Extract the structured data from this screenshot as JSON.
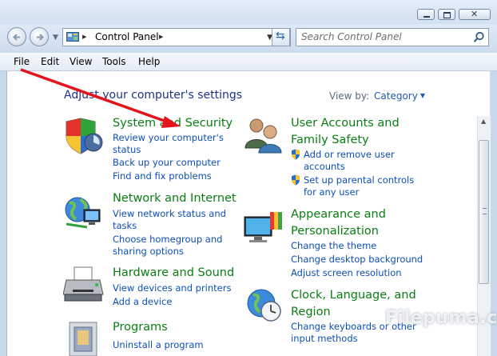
{
  "address_bar": {
    "crumb": "Control Panel",
    "search_placeholder": "Search Control Panel"
  },
  "menubar": [
    "File",
    "Edit",
    "View",
    "Tools",
    "Help"
  ],
  "heading": "Adjust your computer's settings",
  "view_by": {
    "label": "View by:",
    "value": "Category"
  },
  "categories": [
    {
      "title": [
        "System and Security"
      ],
      "links": [
        [
          "Review your computer's",
          "status"
        ],
        [
          "Back up your computer"
        ],
        [
          "Find and fix problems"
        ]
      ]
    },
    {
      "title": [
        "Network and Internet"
      ],
      "links": [
        [
          "View network status and",
          "tasks"
        ],
        [
          "Choose homegroup and",
          "sharing options"
        ]
      ]
    },
    {
      "title": [
        "Hardware and Sound"
      ],
      "links": [
        [
          "View devices and printers"
        ],
        [
          "Add a device"
        ]
      ]
    },
    {
      "title": [
        "Programs"
      ],
      "links": [
        [
          "Uninstall a program"
        ]
      ]
    },
    {
      "title": [
        "User Accounts and",
        "Family Safety"
      ],
      "links": [
        [
          "Add or remove user",
          "accounts"
        ],
        [
          "Set up parental controls",
          "for any user"
        ]
      ]
    },
    {
      "title": [
        "Appearance and",
        "Personalization"
      ],
      "links": [
        [
          "Change the theme"
        ],
        [
          "Change desktop background"
        ],
        [
          "Adjust screen resolution"
        ]
      ]
    },
    {
      "title": [
        "Clock, Language, and",
        "Region"
      ],
      "links": [
        [
          "Change keyboards or other",
          "input methods"
        ]
      ]
    }
  ],
  "watermark": "Filepuma.com",
  "colors": {
    "heading": "#0a7e12",
    "link": "#0d4fb8",
    "title": "#1e3287",
    "arrow": "#e3141c"
  }
}
